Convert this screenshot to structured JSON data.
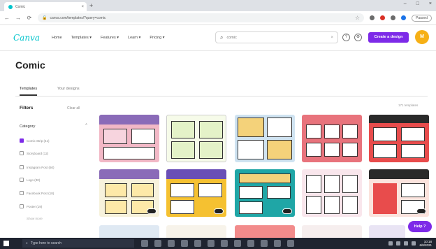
{
  "browser": {
    "tab_title": "Comic",
    "new_tab_glyph": "+",
    "close_glyph": "×",
    "window_controls": [
      "–",
      "□",
      "×"
    ],
    "back_glyph": "←",
    "forward_glyph": "→",
    "reload_glyph": "⟳",
    "url": "canva.com/templates/?query=comic",
    "profile_label": "Paused"
  },
  "canva": {
    "logo": "Canva",
    "nav": [
      "Home",
      "Templates ▾",
      "Features ▾",
      "Learn ▾",
      "Pricing ▾"
    ],
    "search_placeholder": "comic",
    "help_glyph": "?",
    "gear_glyph": "⚙",
    "create_button": "Create a design",
    "avatar_initial": "M",
    "brand_color": "#7d2ae8",
    "logo_color": "#00c4cc"
  },
  "page": {
    "title": "Comic",
    "tabs": [
      "Templates",
      "Your designs"
    ],
    "filters_title": "Filters",
    "clear_all": "Clear all",
    "category_label": "Category",
    "category_items": [
      {
        "label": "Comic Strip (41)",
        "checked": true
      },
      {
        "label": "Storyboard (12)",
        "checked": false
      },
      {
        "label": "Instagram Post (60)",
        "checked": false
      },
      {
        "label": "Logo (30)",
        "checked": false
      },
      {
        "label": "Facebook Post (18)",
        "checked": false
      },
      {
        "label": "Poster (19)",
        "checked": false
      }
    ],
    "show_more": "Show more",
    "results_count": "171 templates"
  },
  "help_fab": "Help ?",
  "taskbar": {
    "search_placeholder": "Type here to search",
    "time": "10:18",
    "date": "6/8/2021"
  }
}
